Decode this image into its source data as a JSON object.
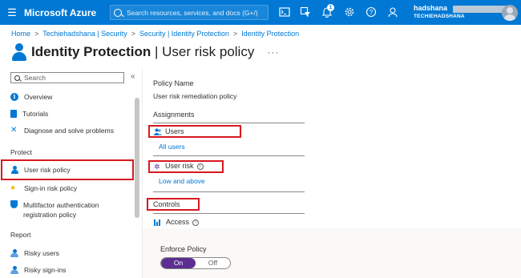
{
  "topbar": {
    "brand": "Microsoft Azure",
    "search_placeholder": "Search resources, services, and docs (G+/)",
    "notification_count": "1",
    "user_name": "hadshana",
    "user_tenant": "TECHIEHADSHANA",
    "icons": [
      "cloud-shell-icon",
      "directory-filter-icon",
      "notifications-icon",
      "settings-icon",
      "help-icon",
      "feedback-icon"
    ]
  },
  "breadcrumb": [
    "Home",
    "Techiehadshana | Security",
    "Security | Identity Protection",
    "Identity Protection"
  ],
  "page": {
    "title_bold": "Identity Protection",
    "title_rest": " | User risk policy",
    "more": "···"
  },
  "sidebar": {
    "search_placeholder": "Search",
    "collapse": "«",
    "items_top": [
      {
        "label": "Overview",
        "icon": "info-icon"
      },
      {
        "label": "Tutorials",
        "icon": "book-icon"
      },
      {
        "label": "Diagnose and solve problems",
        "icon": "wrench-icon"
      }
    ],
    "section_protect": "Protect",
    "items_protect": [
      {
        "label": "User risk policy",
        "icon": "user-icon"
      },
      {
        "label": "Sign-in risk policy",
        "icon": "lightbulb-icon"
      },
      {
        "label_1": "Multifactor authentication",
        "label_2": "registration policy",
        "icon": "shield-icon"
      }
    ],
    "section_report": "Report",
    "items_report": [
      {
        "label": "Risky users",
        "icon": "users-icon"
      },
      {
        "label": "Risky sign-ins",
        "icon": "users-icon"
      }
    ]
  },
  "policy": {
    "name_label": "Policy Name",
    "name_value": "User risk remediation policy",
    "assignments_heading": "Assignments",
    "users_label": "Users",
    "users_value": "All users",
    "user_risk_label": "User risk",
    "user_risk_value": "Low and above",
    "controls_heading": "Controls",
    "access_label": "Access",
    "enforce_label": "Enforce Policy",
    "toggle_on": "On",
    "toggle_off": "Off",
    "toggle_state": "On",
    "toggle_on_color": "#5c2e91"
  },
  "colors": {
    "azure_blue": "#0078d4",
    "highlight_red": "#d71920"
  }
}
